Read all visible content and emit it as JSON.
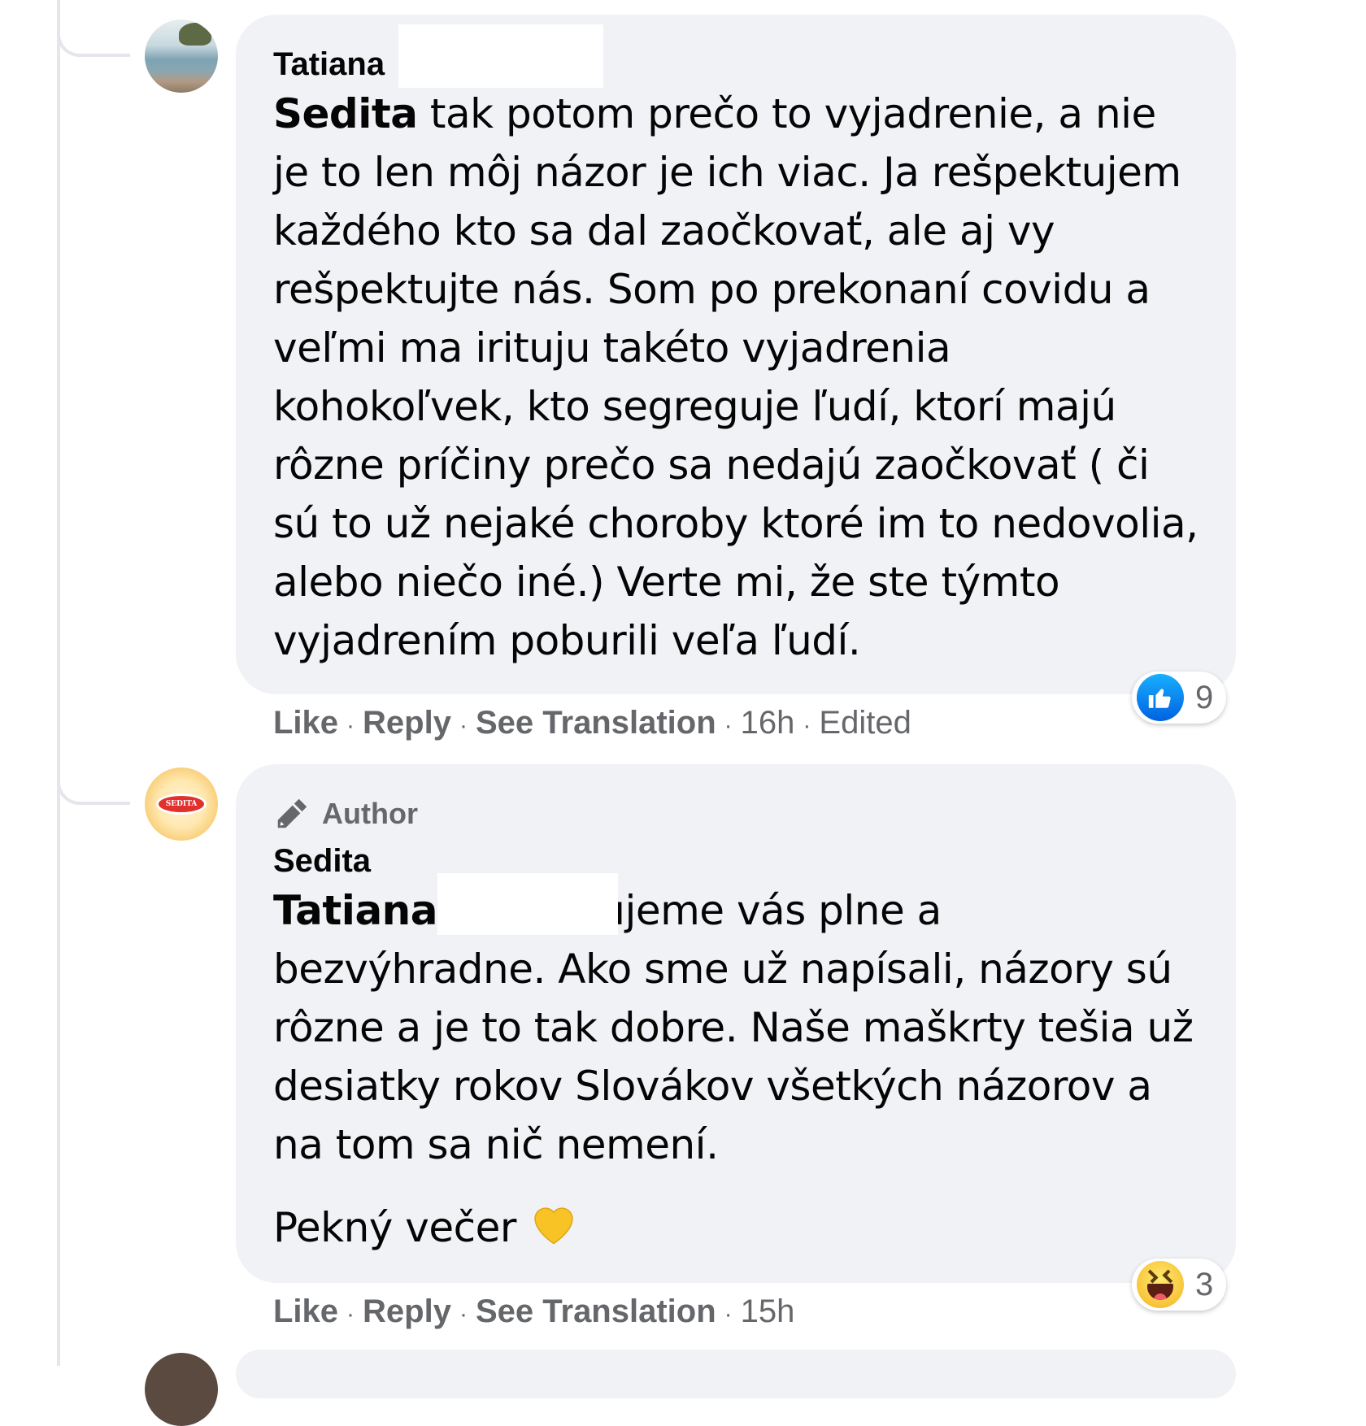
{
  "comments": [
    {
      "author": "Tatiana",
      "mention": "Sedita",
      "text": " tak potom prečo to vyjadrenie, a nie je to len môj názor je ich viac. Ja rešpektujem každého kto sa dal zaočkovať, ale aj vy rešpektujte nás. Som po prekonaní covidu a veľmi ma irituju takéto vyjadrenia kohokoľvek, kto segreguje ľudí, ktorí majú rôzne príčiny prečo sa nedajú zaočkovať ( či sú to už nejaké choroby ktoré im to nedovolia, alebo niečo iné.) Verte mi, že ste týmto vyjadrením poburili veľa ľudí.",
      "actions": {
        "like": "Like",
        "reply": "Reply",
        "translate": "See Translation",
        "time": "16h",
        "edited": "Edited"
      },
      "reaction": {
        "icon": "like-icon",
        "count": "9"
      }
    },
    {
      "badge": "Author",
      "author": "Sedita",
      "mention": "Tatiana",
      "text": " rešpektujeme vás plne a bezvýhradne. Ako sme už napísali, názory sú rôzne a je to tak dobre. Naše maškrty tešia už desiatky rokov Slovákov všetkých názorov a na tom sa nič nemení.",
      "signoff": "Pekný večer",
      "actions": {
        "like": "Like",
        "reply": "Reply",
        "translate": "See Translation",
        "time": "15h"
      },
      "reaction": {
        "icon": "haha-icon",
        "count": "3"
      }
    }
  ],
  "colors": {
    "bubble": "#f0f2f5",
    "meta": "#65676b",
    "like": "#1877f2",
    "heart": "#f7c325"
  }
}
